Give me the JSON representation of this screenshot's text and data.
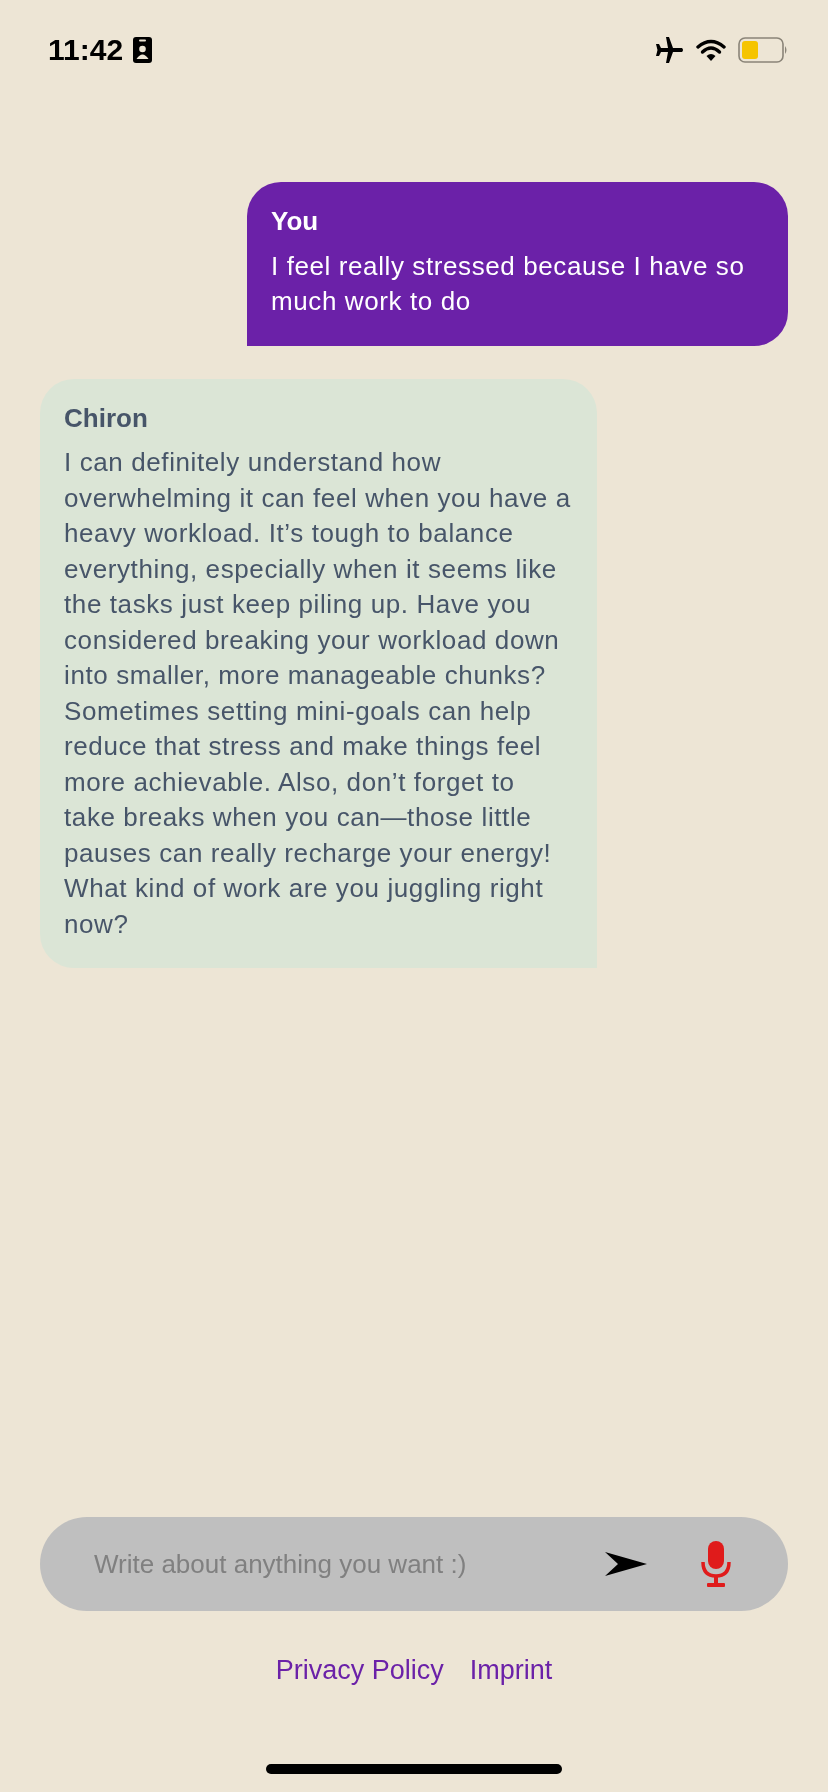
{
  "status_bar": {
    "time": "11:42"
  },
  "messages": [
    {
      "kind": "user",
      "sender": "You",
      "text": "I feel really stressed because I have so much work to do"
    },
    {
      "kind": "bot",
      "sender": "Chiron",
      "text": "I can definitely understand how overwhelming it can feel when you have a heavy workload. It’s tough to balance everything, especially when it seems like the tasks just keep piling up. Have you considered breaking your workload down into smaller, more manageable chunks? Sometimes setting mini-goals can help reduce that stress and make things feel more achievable. Also, don’t forget to take breaks when you can—those little pauses can really recharge your energy! What kind of work are you juggling right now?"
    }
  ],
  "composer": {
    "placeholder": "Write about anything you want :)"
  },
  "footer_links": [
    "Privacy Policy",
    "Imprint"
  ]
}
